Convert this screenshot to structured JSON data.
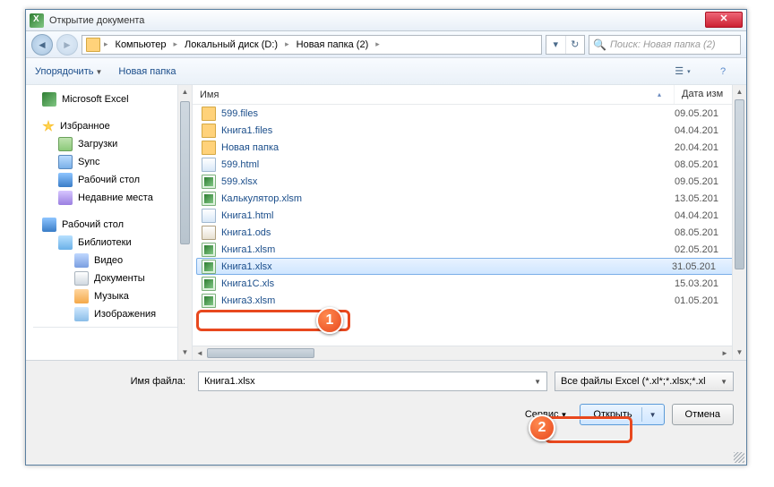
{
  "window": {
    "title": "Открытие документа"
  },
  "nav": {
    "crumbs": [
      "Компьютер",
      "Локальный диск (D:)",
      "Новая папка (2)"
    ],
    "search_placeholder": "Поиск: Новая папка (2)"
  },
  "toolbar": {
    "organize": "Упорядочить",
    "new_folder": "Новая папка"
  },
  "sidebar": {
    "excel": "Microsoft Excel",
    "fav": "Избранное",
    "downloads": "Загрузки",
    "sync": "Sync",
    "desktop1": "Рабочий стол",
    "recent": "Недавние места",
    "desktop2": "Рабочий стол",
    "libs": "Библиотеки",
    "video": "Видео",
    "docs": "Документы",
    "music": "Музыка",
    "images": "Изображения"
  },
  "columns": {
    "name": "Имя",
    "date": "Дата изм"
  },
  "files": [
    {
      "icon": "fld",
      "name": "599.files",
      "date": "09.05.201"
    },
    {
      "icon": "fld",
      "name": "Книга1.files",
      "date": "04.04.201"
    },
    {
      "icon": "fld",
      "name": "Новая папка",
      "date": "20.04.201"
    },
    {
      "icon": "html",
      "name": "599.html",
      "date": "08.05.201"
    },
    {
      "icon": "xlsx",
      "name": "599.xlsx",
      "date": "09.05.201"
    },
    {
      "icon": "xlsx",
      "name": "Калькулятор.xlsm",
      "date": "13.05.201"
    },
    {
      "icon": "html",
      "name": "Книга1.html",
      "date": "04.04.201"
    },
    {
      "icon": "ods",
      "name": "Книга1.ods",
      "date": "08.05.201"
    },
    {
      "icon": "xlsx",
      "name": "Книга1.xlsm",
      "date": "02.05.201"
    },
    {
      "icon": "xlsx",
      "name": "Книга1.xlsx",
      "date": "31.05.201",
      "selected": true
    },
    {
      "icon": "xlsx",
      "name": "Книга1С.xls",
      "date": "15.03.201"
    },
    {
      "icon": "xlsx",
      "name": "Книга3.xlsm",
      "date": "01.05.201"
    }
  ],
  "bottom": {
    "file_label": "Имя файла:",
    "file_value": "Книга1.xlsx",
    "type_value": "Все файлы Excel (*.xl*;*.xlsx;*.xl",
    "service": "Сервис",
    "open": "Открыть",
    "cancel": "Отмена"
  },
  "callouts": {
    "one": "1",
    "two": "2"
  }
}
